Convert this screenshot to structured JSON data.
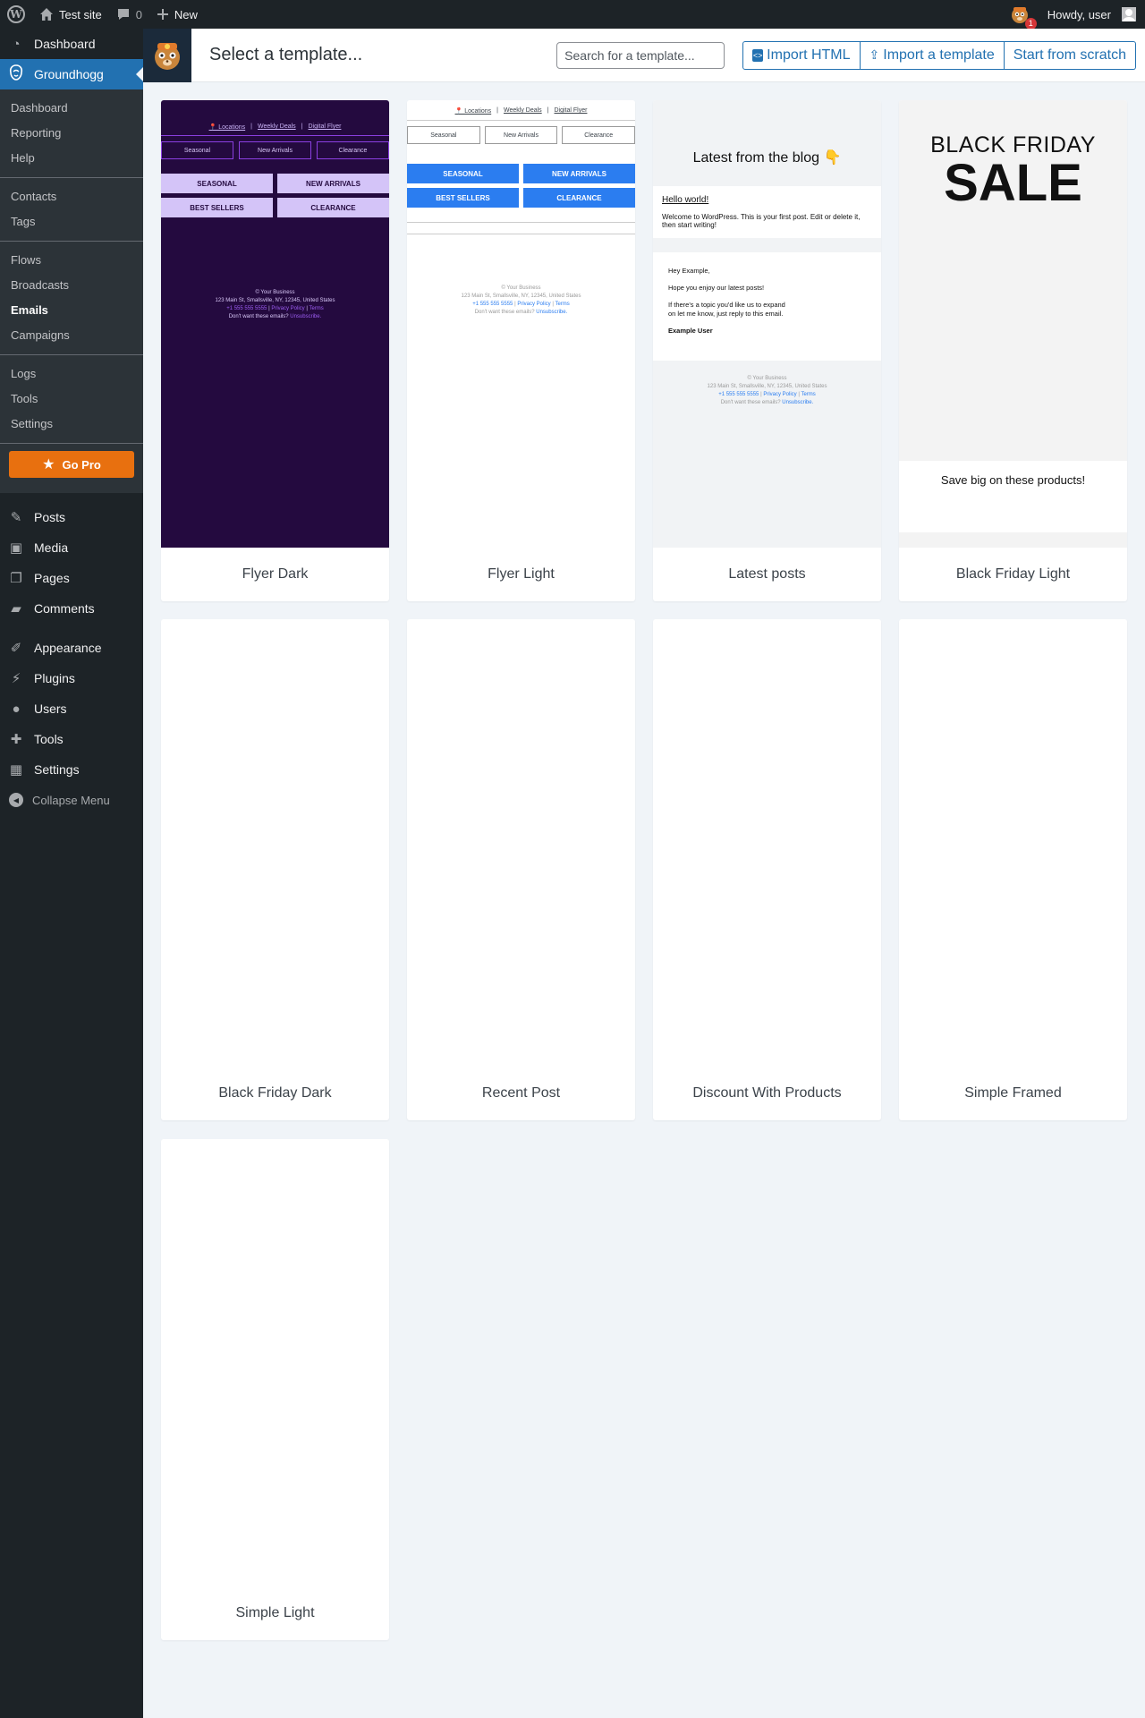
{
  "adminbar": {
    "site_name": "Test site",
    "comments_count": "0",
    "new_label": "New",
    "notification_count": "1",
    "howdy": "Howdy, user"
  },
  "sidebar": {
    "dashboard": "Dashboard",
    "groundhogg": "Groundhogg",
    "submenu": {
      "group1": [
        "Dashboard",
        "Reporting",
        "Help"
      ],
      "group2": [
        "Contacts",
        "Tags"
      ],
      "group3": [
        "Flows",
        "Broadcasts",
        "Emails",
        "Campaigns"
      ],
      "group4": [
        "Logs",
        "Tools",
        "Settings"
      ],
      "current": "Emails"
    },
    "go_pro": "Go Pro",
    "items": [
      "Posts",
      "Media",
      "Pages",
      "Comments",
      "Appearance",
      "Plugins",
      "Users",
      "Tools",
      "Settings"
    ],
    "collapse": "Collapse Menu"
  },
  "header": {
    "title": "Select a template...",
    "search_placeholder": "Search for a template...",
    "import_html": "Import HTML",
    "import_template": "Import a template",
    "start_scratch": "Start from scratch"
  },
  "colors": {
    "wp_dark": "#1d2327",
    "wp_blue": "#2271b1",
    "go_pro_orange": "#e8700f",
    "flyer_dark_bg": "#240a3f",
    "flyer_light_button": "#2b7df0"
  },
  "templates": [
    {
      "name": "Flyer Dark"
    },
    {
      "name": "Flyer Light"
    },
    {
      "name": "Latest posts"
    },
    {
      "name": "Black Friday Light"
    },
    {
      "name": "Black Friday Dark"
    },
    {
      "name": "Recent Post"
    },
    {
      "name": "Discount With Products"
    },
    {
      "name": "Simple Framed"
    },
    {
      "name": "Simple Light"
    }
  ],
  "flyer": {
    "nav": [
      "📍 Locations",
      "Weekly Deals",
      "Digital Flyer"
    ],
    "outline_buttons": [
      "Seasonal",
      "New Arrivals",
      "Clearance"
    ],
    "buttons": [
      "SEASONAL",
      "NEW ARRIVALS",
      "BEST SELLERS",
      "CLEARANCE"
    ],
    "footer": {
      "line1": "© Your Business",
      "line2": "123 Main St, Smallsville, NY, 12345, United States",
      "phone": "+1 555 555 5555",
      "privacy": "Privacy Policy",
      "terms": "Terms",
      "unsub_text": "Don't want these emails?",
      "unsub_link": "Unsubscribe."
    }
  },
  "latest_posts": {
    "title": "Latest from the blog 👇",
    "post_title": "Hello world!",
    "post_excerpt": "Welcome to WordPress. This is your first post. Edit or delete it, then start writing!",
    "greeting": "Hey Example,",
    "body1": "Hope you enjoy our latest posts!",
    "body2": "If there's a topic you'd like us to expand on let me know, just reply to this email.",
    "signature": "Example User"
  },
  "black_friday": {
    "line1": "BLACK FRIDAY",
    "line2": "SALE",
    "tagline": "Save big on these products!"
  }
}
